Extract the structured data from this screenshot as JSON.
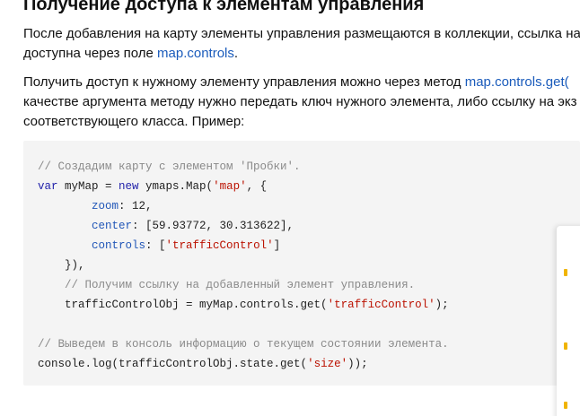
{
  "heading": "Получение доступа к элементам управления",
  "para1": {
    "line1": "После добавления на карту элементы управления размещаются в коллекции, ссылка на",
    "line2_text": "доступна через поле ",
    "line2_link": "map.controls",
    "line2_end": "."
  },
  "para2": {
    "line1_text": "Получить доступ к нужному элементу управления можно через метод ",
    "line1_link": "map.controls.get(",
    "line2": "качестве аргумента методу нужно передать ключ нужного элемента, либо ссылку на экз",
    "line3": "соответствующего класса. Пример:"
  },
  "code": {
    "l1": "// Создадим карту с элементом 'Пробки'.",
    "l2_kw": "var",
    "l2_a": " myMap = ",
    "l2_kw2": "new",
    "l2_b": " ymaps.Map(",
    "l2_str": "'map'",
    "l2_c": ", {",
    "l3_prop": "zoom",
    "l3_rest": ": 12,",
    "l4_prop": "center",
    "l4_rest": ": [59.93772, 30.313622],",
    "l5_prop": "controls",
    "l5_a": ": [",
    "l5_str": "'trafficControl'",
    "l5_b": "]",
    "l6": "}),",
    "l7": "// Получим ссылку на добавленный элемент управления.",
    "l8_a": "trafficControlObj = myMap.controls.get(",
    "l8_str": "'trafficControl'",
    "l8_b": ");",
    "l10": "// Выведем в консоль информацию о текущем состоянии элемента.",
    "l11_a": "console.log(trafficControlObj.state.get(",
    "l11_str": "'size'",
    "l11_b": "));"
  },
  "colors": {
    "link": "#1a5bbb",
    "code_background": "#f4f4f4",
    "code_comment": "#8a8a8a",
    "code_keyword": "#2222aa",
    "code_string": "#bb1100",
    "code_property": "#2257b8",
    "overlay_accent": "#f0b400"
  }
}
